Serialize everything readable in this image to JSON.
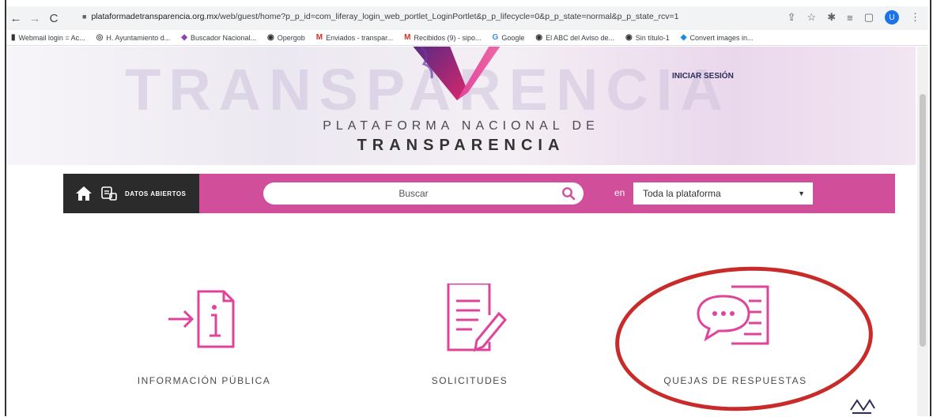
{
  "browser": {
    "url_host": "plataformadetransparencia.org.mx",
    "url_path": "/web/guest/home?p_p_id=com_liferay_login_web_portlet_LoginPortlet&p_p_lifecycle=0&p_p_state=normal&p_p_state_rcv=1",
    "avatar_letter": "U",
    "bookmarks": [
      "Webmail login = Ac...",
      "H. Ayuntamiento d...",
      "Buscador Nacional...",
      "Opergob",
      "Enviados - transpar...",
      "Recibidos (9) - sipo...",
      "Google",
      "El ABC del Aviso de...",
      "Sin título-1",
      "Convert images in..."
    ]
  },
  "header": {
    "login_label": "INICIAR SESIÓN",
    "brand_line1": "PLATAFORMA NACIONAL DE",
    "brand_line2": "TRANSPARENCIA",
    "watermark": "TRANSPARENCIA"
  },
  "search": {
    "open_data_label": "DATOS ABIERTOS",
    "placeholder": "Buscar",
    "scope_prefix": "en",
    "scope_value": "Toda la plataforma"
  },
  "cards": [
    {
      "label": "INFORMACIÓN PÚBLICA"
    },
    {
      "label": "SOLICITUDES"
    },
    {
      "label": "QUEJAS DE RESPUESTAS"
    }
  ],
  "colors": {
    "accent": "#d14e9b",
    "icon": "#e0439b",
    "annotation": "#c92a2a"
  }
}
